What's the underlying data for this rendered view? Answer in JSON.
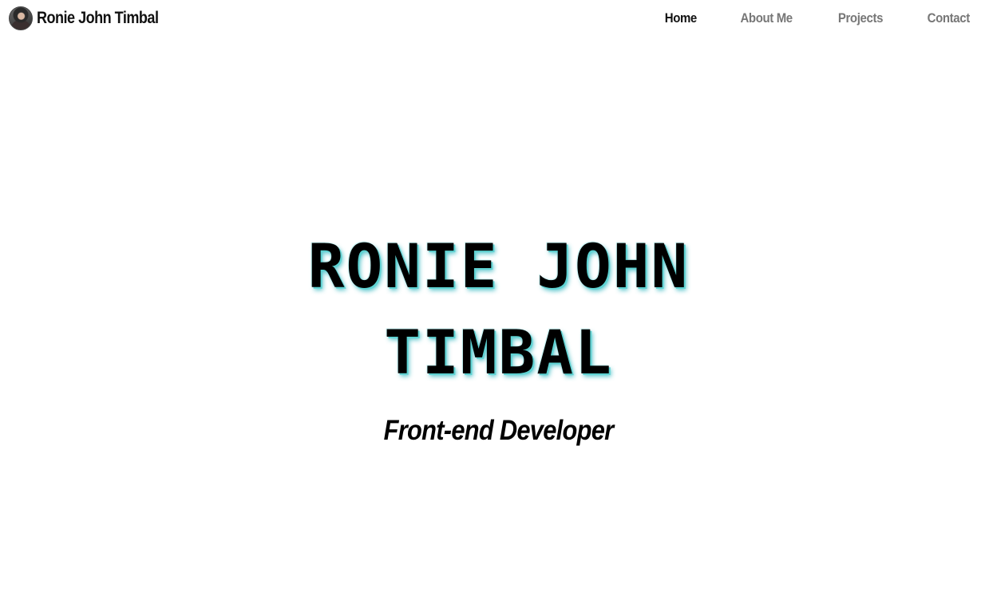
{
  "brand": {
    "name": "Ronie John Timbal",
    "avatar_icon": "profile-photo"
  },
  "nav": {
    "items": [
      {
        "label": "Home",
        "active": true
      },
      {
        "label": "About Me",
        "active": false
      },
      {
        "label": "Projects",
        "active": false
      },
      {
        "label": "Contact",
        "active": false
      }
    ]
  },
  "hero": {
    "title": "RONIE JOHN TIMBAL",
    "subtitle": "Front-end Developer"
  },
  "colors": {
    "text": "#000000",
    "nav_inactive": "#777777",
    "title_glow": "#5fd3d3",
    "background": "#ffffff"
  }
}
